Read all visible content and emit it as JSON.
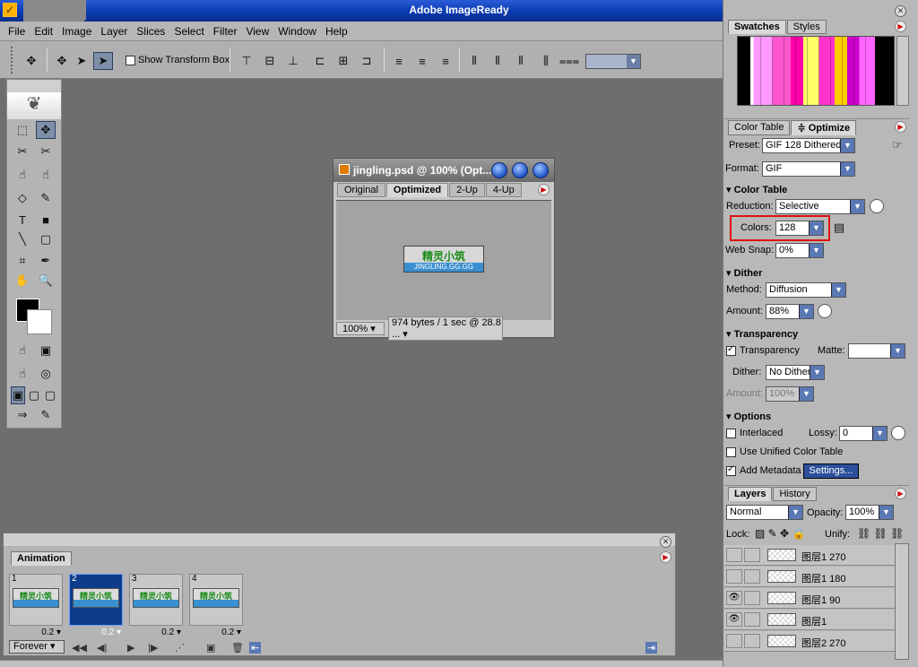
{
  "app": {
    "title": "Adobe ImageReady"
  },
  "menu": [
    "File",
    "Edit",
    "Image",
    "Layer",
    "Slices",
    "Select",
    "Filter",
    "View",
    "Window",
    "Help"
  ],
  "options_bar": {
    "show_transform_box": "Show Transform Box"
  },
  "document": {
    "title": "jingling.psd @ 100% (Opt...",
    "tabs": [
      "Original",
      "Optimized",
      "2-Up",
      "4-Up"
    ],
    "active_tab": "Optimized",
    "banner_text": "精灵小筑",
    "banner_subtext": "JINGLING.GG.GG",
    "zoom": "100%",
    "info": "974 bytes / 1 sec @ 28.8 ..."
  },
  "swatches_panel": {
    "tabs": [
      "Swatches",
      "Styles"
    ]
  },
  "optimize_panel": {
    "tabs": [
      "Color Table",
      "≑ Optimize"
    ],
    "preset_label": "Preset:",
    "preset": "GIF 128 Dithered",
    "format_label": "Format:",
    "format": "GIF",
    "color_table_header": "Color Table",
    "reduction_label": "Reduction:",
    "reduction": "Selective",
    "colors_label": "Colors:",
    "colors": "128",
    "websnap_label": "Web Snap:",
    "websnap": "0%",
    "dither_header": "Dither",
    "method_label": "Method:",
    "method": "Diffusion",
    "amount_label": "Amount:",
    "amount": "88%",
    "transparency_header": "Transparency",
    "transparency_label": "Transparency",
    "matte_label": "Matte:",
    "tdither_label": "Dither:",
    "tdither": "No Dither",
    "tamount_label": "Amount:",
    "tamount": "100%",
    "options_header": "Options",
    "interlaced": "Interlaced",
    "lossy_label": "Lossy:",
    "lossy": "0",
    "unified": "Use Unified Color Table",
    "metadata": "Add Metadata",
    "settings": "Settings..."
  },
  "layers_panel": {
    "tabs": [
      "Layers",
      "History"
    ],
    "blend": "Normal",
    "opacity_label": "Opacity:",
    "opacity": "100%",
    "lock_label": "Lock:",
    "unify_label": "Unify:",
    "layers": [
      "图层1 270",
      "图层1 180",
      "图层1 90",
      "图层1",
      "图层2 270"
    ]
  },
  "animation_panel": {
    "title": "Animation",
    "frames": [
      {
        "num": "1",
        "delay": "0.2"
      },
      {
        "num": "2",
        "delay": "0.2"
      },
      {
        "num": "3",
        "delay": "0.2"
      },
      {
        "num": "4",
        "delay": "0.2"
      }
    ],
    "frame_text": "精灵小筑",
    "loop": "Forever"
  }
}
